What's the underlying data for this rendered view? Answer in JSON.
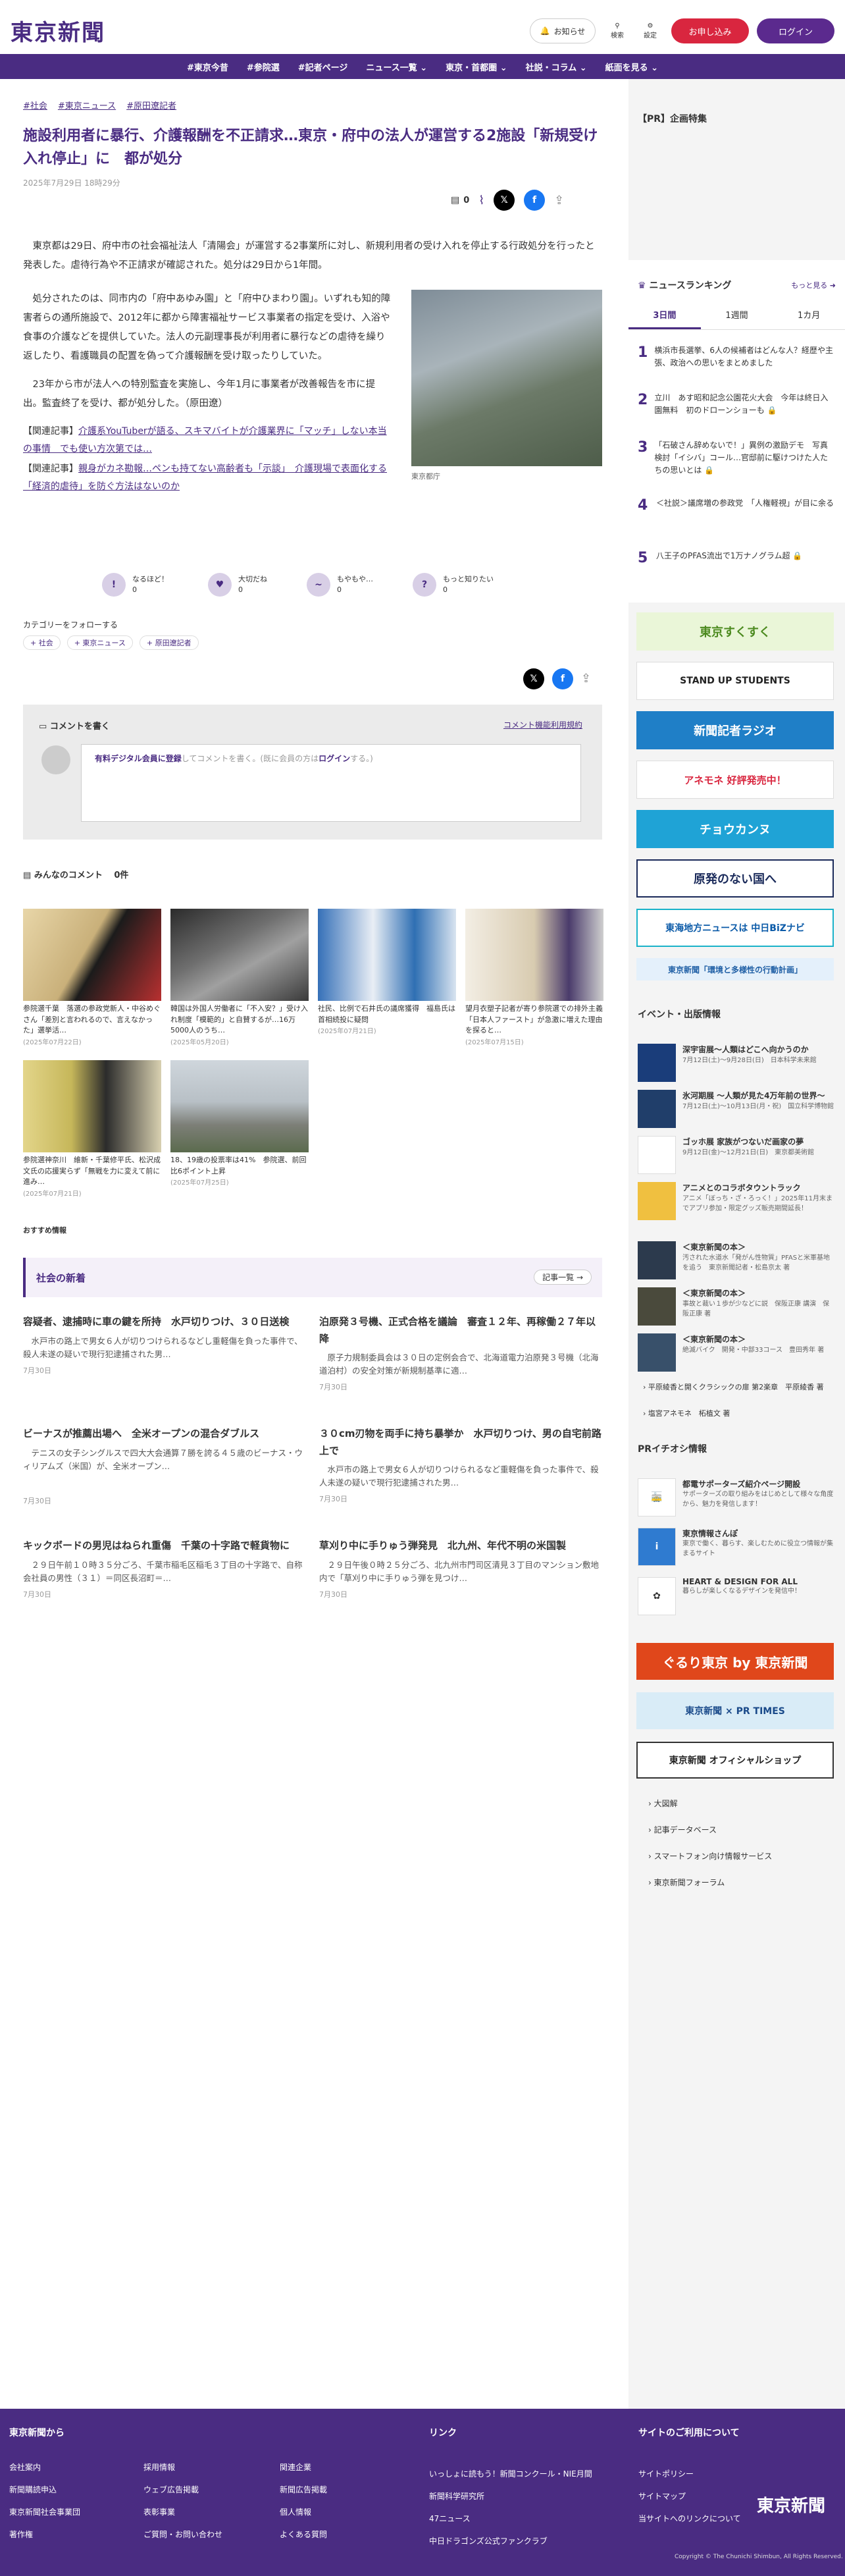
{
  "header": {
    "logo": "東京新聞",
    "notify": "お知らせ",
    "search": "検索",
    "settings": "設定",
    "signup": "お申し込み",
    "login": "ログイン"
  },
  "nav": [
    "#東京今昔",
    "#参院選",
    "#記者ページ",
    "ニュース一覧 ⌄",
    "東京・首都圏 ⌄",
    "社説・コラム ⌄",
    "紙面を見る ⌄"
  ],
  "article": {
    "tags": [
      "#社会",
      "#東京ニュース",
      "#原田遼記者"
    ],
    "title": "施設利用者に暴行、介護報酬を不正請求…東京・府中の法人が運営する2施設「新規受け入れ停止」に　都が処分",
    "date": "2025年7月29日 18時29分",
    "comment_count": "0",
    "p1": "東京都は29日、府中市の社会福祉法人「清陽会」が運営する2事業所に対し、新規利用者の受け入れを停止する行政処分を行ったと発表した。虐待行為や不正請求が確認された。処分は29日から1年間。",
    "p2": "処分されたのは、同市内の「府中あゆみ園」と「府中ひまわり園」。いずれも知的障害者らの通所施設で、2012年に都から障害福祉サービス事業者の指定を受け、入浴や食事の介護などを提供していた。法人の元副理事長が利用者に暴行などの虐待を繰り返したり、看護職員の配置を偽って介護報酬を受け取ったりしていた。",
    "p3": "23年から市が法人への特別監査を実施し、今年1月に事業者が改善報告を市に提出。監査終了を受け、都が処分した。（原田遼）",
    "image_caption": "東京都庁",
    "rel1_label": "【関連記事】",
    "rel1": "介護系YouTuberが語る、スキマバイトが介護業界に「マッチ」しない本当の事情　でも使い方次第では…",
    "rel2_label": "【関連記事】",
    "rel2": "親身がカネ勘報…ペンも持てない高齢者も「示談」　介護現場で表面化する「経済的虐待」を防ぐ方法はないのか",
    "reactions": [
      {
        "icon": "!",
        "label": "なるほど！",
        "count": "0"
      },
      {
        "icon": "♥",
        "label": "大切だね",
        "count": "0"
      },
      {
        "icon": "~",
        "label": "もやもや…",
        "count": "0"
      },
      {
        "icon": "?",
        "label": "もっと知りたい",
        "count": "0"
      }
    ],
    "follow_label": "カテゴリーをフォローする",
    "follow_chips": [
      "+ 社会",
      "+ 東京ニュース",
      "+ 原田遼記者"
    ],
    "comment_header": "コメントを書く",
    "comment_rules": "コメント機能利用規約",
    "comment_placeholder_link": "有料デジタル会員に登録",
    "comment_placeholder_mid": "してコメントを書く。(既に会員の方は",
    "comment_placeholder_login": "ログイン",
    "comment_placeholder_end": "する。)",
    "comments_count_label": "みんなのコメント　 0件"
  },
  "photos": [
    {
      "title": "参院選千葉　落選の参政党新人・中谷めぐさん「差別と言われるので、言えなかった」選挙活…",
      "date": "(2025年07月22日)"
    },
    {
      "title": "韓国は外国人労働者に「不入安？」受け入れ制度「模範的」と自賛するが…16万5000人のうち…",
      "date": "(2025年05月20日)"
    },
    {
      "title": "社民、比例で石井氏の議席獲得　福島氏は首相続投に疑問",
      "date": "(2025年07月21日)"
    },
    {
      "title": "望月衣塑子記者が寄り参院選での排外主義「日本人ファースト」が急激に増えた理由を探ると…",
      "date": "(2025年07月15日)"
    },
    {
      "title": "参院選神奈川　維新・千葉修平氏、松沢成文氏の応援実らず「無戦を力に変えて前に進み…",
      "date": "(2025年07月21日)"
    },
    {
      "title": "18、19歳の投票率は41%　参院選、前回比6ポイント上昇",
      "date": "(2025年07月25日)"
    }
  ],
  "osusume": "おすすめ情報",
  "shakai": {
    "title": "社会の新着",
    "more": "記事一覧 →",
    "items": [
      {
        "title": "容疑者、逮捕時に車の鍵を所持　水戸切りつけ、３０日送検",
        "body": "水戸市の路上で男女６人が切りつけられるなどし重軽傷を負った事件で、殺人未遂の疑いで現行犯逮捕された男…",
        "date": "7月30日"
      },
      {
        "title": "泊原発３号機、正式合格を議論　審査１２年、再稼働２７年以降",
        "body": "原子力規制委員会は３０日の定例会合で、北海道電力泊原発３号機（北海道泊村）の安全対策が新規制基準に適…",
        "date": "7月30日"
      },
      {
        "title": "ビーナスが推薦出場へ　全米オープンの混合ダブルス",
        "body": "テニスの女子シングルスで四大大会通算７勝を誇る４５歳のビーナス・ウィリアムズ（米国）が、全米オープン…",
        "date": "7月30日"
      },
      {
        "title": "３０cm刃物を両手に持ち暴挙か　水戸切りつけ、男の自宅前路上で",
        "body": "水戸市の路上で男女６人が切りつけられるなど重軽傷を負った事件で、殺人未遂の疑いで現行犯逮捕された男…",
        "date": "7月30日"
      },
      {
        "title": "キックボードの男児はねられ重傷　千葉の十字路で軽貨物に",
        "body": "２９日午前１０時３５分ごろ、千葉市稲毛区稲毛３丁目の十字路で、自称会社員の男性（３１）＝同区長沼町＝…",
        "date": "7月30日"
      },
      {
        "title": "草刈り中に手りゅう弾発見　北九州、年代不明の米国製",
        "body": "２９日午後０時２５分ごろ、北九州市門司区清見３丁目のマンション敷地内で「草刈り中に手りゅう弾を見つけ…",
        "date": "7月30日"
      }
    ]
  },
  "sidebar": {
    "pr_header": "【PR】企画特集",
    "ranking_title": "ニュースランキング",
    "ranking_more": "もっと見る ➜",
    "ranking_tabs": [
      "3日間",
      "1週間",
      "1カ月"
    ],
    "ranking": [
      {
        "n": "1",
        "t": "横浜市長選挙、6人の候補者はどんな人？経歴や主張、政治への思いをまとめました"
      },
      {
        "n": "2",
        "t": "立川　あす昭和記念公園花火大会　今年は終日入園無料　初のドローンショーも 🔒"
      },
      {
        "n": "3",
        "t": "「石破さん辞めないで！」異例の激励デモ　写真検討「イシバ」コール…官邸前に駆けつけた人たちの思いとは 🔒"
      },
      {
        "n": "4",
        "t": "＜社説＞議席増の参政党　「人権軽視」が目に余る"
      },
      {
        "n": "5",
        "t": "八王子のPFAS流出で1万ナノグラム超 🔒"
      }
    ],
    "banners": [
      "東京すくすく",
      "STAND UP STUDENTS",
      "新聞記者ラジオ",
      "アネモネ 好評発売中！",
      "チョウカンヌ",
      "原発のない国へ",
      "東海地方ニュースは 中日BiZナビ",
      "東京新聞「環境と多様性の行動計画」"
    ],
    "events_title": "イベント・出版情報",
    "events": [
      {
        "t": "深宇宙展〜人類はどこへ向かうのか",
        "s": "7月12日(土)〜9月28日(日)　日本科学未来館"
      },
      {
        "t": "氷河期展 〜人類が見た4万年前の世界〜",
        "s": "7月12日(土)〜10月13日(月・祝)　国立科学博物館"
      },
      {
        "t": "ゴッホ展 家族がつないだ画家の夢",
        "s": "9月12日(金)〜12月21日(日)　東京都美術館"
      },
      {
        "t": "アニメとのコラボタウントラック",
        "s": "アニメ「ぼっち・ざ・ろっく！」2025年11月末までアプリ参加・限定グッズ販売期間延長！"
      },
      {
        "t": "＜東京新聞の本＞",
        "s": "汚された水道水「発がん性物質」PFASと米軍基地を追う　東京新聞記者・松島京太 著"
      },
      {
        "t": "＜東京新聞の本＞",
        "s": "事故と裁い１歩が少などに説　保阪正康 講演　保阪正康 著"
      },
      {
        "t": "＜東京新聞の本＞",
        "s": "絶滅バイク　開発・中部33コース　豊田秀年 著"
      }
    ],
    "event_links": [
      "平原綾香と開くクラシックの扉 第2楽章　平原綾香 著",
      "塩宮アネモネ　柘植文 著"
    ],
    "pr_info_title": "PRイチオシ情報",
    "pr_info": [
      {
        "t": "都電サポーターズ紹介ページ開設",
        "s": "サポーターズの取り組みをはじめとして様々な角度から、魅力を発信します！"
      },
      {
        "t": "東京情報さんぽ",
        "s": "東京で働く、暮らす、楽しむために役立つ情報が集まるサイト"
      },
      {
        "t": "HEART & DESIGN FOR ALL",
        "s": "暮らしが楽しくなるデザインを発信中！"
      }
    ],
    "banners2": [
      "ぐるり東京 by 東京新聞",
      "東京新聞 × PR TIMES",
      "東京新聞 オフィシャルショップ"
    ],
    "links": [
      "大図解",
      "記事データベース",
      "スマートフォン向け情報サービス",
      "東京新聞フォーラム"
    ]
  },
  "footer": {
    "col1_title": "東京新聞から",
    "col1": [
      "会社案内",
      "採用情報",
      "新聞購読申込",
      "ウェブ広告掲載",
      "東京新聞社会事業団",
      "表彰事業",
      "著作権",
      "ご質問・お問い合わせ",
      "関連企業",
      "新聞広告掲載",
      "個人情報",
      "よくある質問"
    ],
    "col2_title": "リンク",
    "col2": [
      "いっしょに読もう！新聞コンクール・NIE月間",
      "新聞科学研究所",
      "47ニュース",
      "中日ドラゴンズ公式ファンクラブ"
    ],
    "col3_title": "サイトのご利用について",
    "col3": [
      "サイトポリシー",
      "サイトマップ",
      "当サイトへのリンクについて"
    ],
    "logo": "東京新聞",
    "copyright": "Copyright © The Chunichi Shimbun, All Rights Reserved."
  }
}
